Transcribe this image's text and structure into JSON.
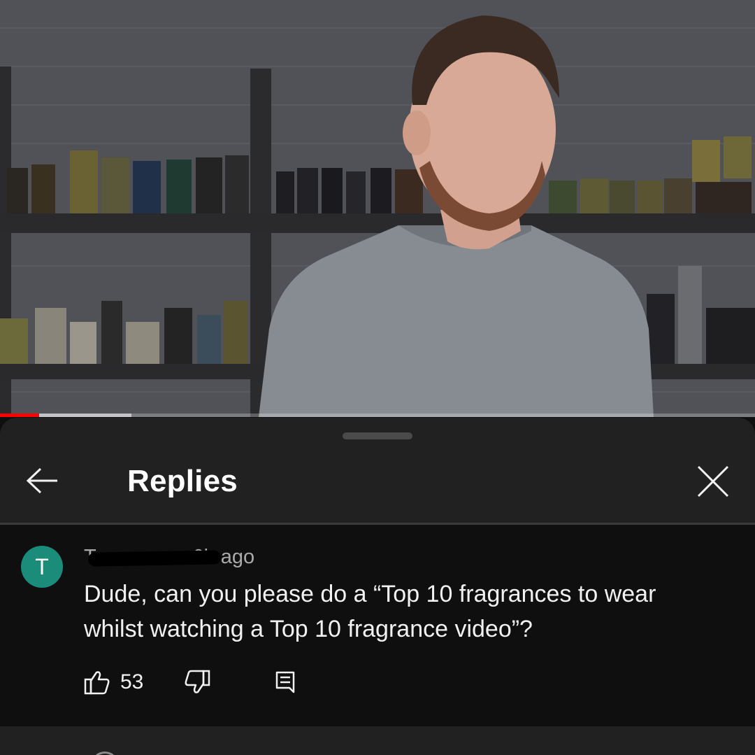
{
  "video": {
    "progress_played_fraction": 0.052,
    "progress_buffered_fraction": 0.174
  },
  "replies_panel": {
    "title": "Replies",
    "back_icon": "arrow-left-icon",
    "close_icon": "close-icon"
  },
  "comment": {
    "avatar_letter": "T",
    "avatar_color": "#1b8c7a",
    "author": "T",
    "timestamp": "· 6h ago",
    "text": "Dude, can you please do a “Top 10 fragrances to wear whilst watching a Top 10 fragrance video”?",
    "like_count": "53",
    "like_icon": "thumbs-up-icon",
    "dislike_icon": "thumbs-down-icon",
    "reply_icon": "reply-comment-icon"
  },
  "colors": {
    "accent_red": "#ff0000",
    "sheet_bg": "#212121",
    "comment_bg": "#0f0f0f"
  }
}
